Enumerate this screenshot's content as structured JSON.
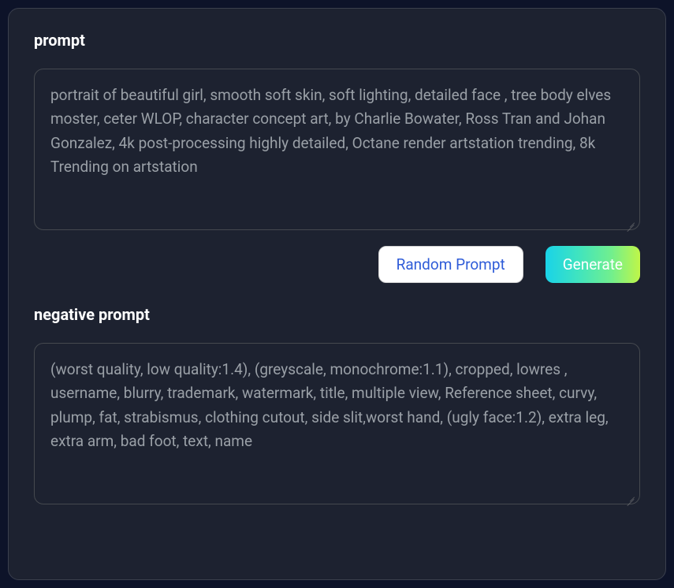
{
  "prompt": {
    "label": "prompt",
    "value": "portrait of beautiful girl, smooth soft skin, soft lighting, detailed face , tree body elves moster, ceter WLOP, character concept art, by Charlie Bowater, Ross Tran and Johan Gonzalez, 4k post-processing highly detailed, Octane render artstation trending, 8k Trending on artstation",
    "random_button": "Random Prompt",
    "generate_button": "Generate"
  },
  "negative": {
    "label": "negative prompt",
    "value": "(worst quality, low quality:1.4), (greyscale, monochrome:1.1), cropped, lowres , username, blurry, trademark, watermark, title, multiple view, Reference sheet, curvy, plump, fat, strabismus, clothing cutout, side slit,worst hand, (ugly face:1.2), extra leg, extra arm, bad foot, text, name"
  }
}
